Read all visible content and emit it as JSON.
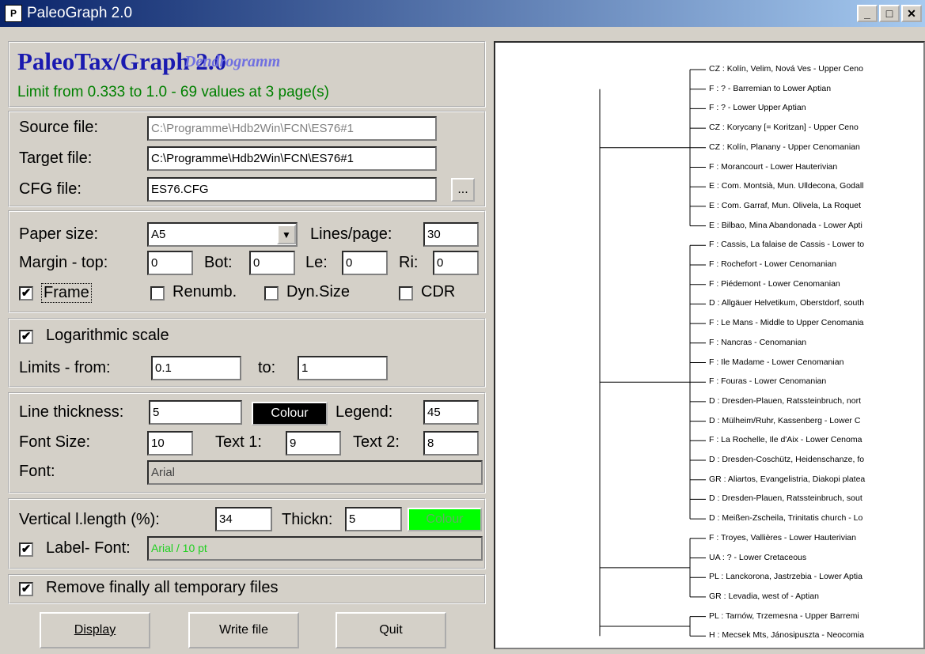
{
  "window": {
    "title": "PaleoGraph 2.0",
    "icon": "app-icon",
    "controls": [
      "_",
      "□",
      "✕"
    ]
  },
  "header": {
    "title": "PaleoTax/Graph 2.0",
    "subtitle": "Dendrogramm",
    "limit_text": "Limit from 0.333 to 1.0 - 69 values at 3 page(s)"
  },
  "files": {
    "source_label": "Source file:",
    "source_value": "C:\\Programme\\Hdb2Win\\FCN\\ES76#1",
    "target_label": "Target file:",
    "target_value": "C:\\Programme\\Hdb2Win\\FCN\\ES76#1",
    "cfg_label": "CFG file:",
    "cfg_value": "ES76.CFG",
    "browse_label": "..."
  },
  "paper": {
    "size_label": "Paper size:",
    "size_value": "A5",
    "lines_label": "Lines/page:",
    "lines_value": "30",
    "margin_label": "Margin - top:",
    "top_value": "0",
    "bot_label": "Bot:",
    "bot_value": "0",
    "le_label": "Le:",
    "le_value": "0",
    "ri_label": "Ri:",
    "ri_value": "0",
    "frame_label": "Frame",
    "frame_checked": "✔",
    "renumb_label": "Renumb.",
    "renumb_checked": "",
    "dynsize_label": "Dyn.Size",
    "dynsize_checked": "",
    "cdr_label": "CDR",
    "cdr_checked": ""
  },
  "scale": {
    "log_label": "Logarithmic scale",
    "log_checked": "✔",
    "limits_label": "Limits - from:",
    "from_value": "0.1",
    "to_label": "to:",
    "to_value": "1"
  },
  "lines": {
    "thickness_label": "Line thickness:",
    "thickness_value": "5",
    "colour_label": "Colour",
    "colour_color": "#000000",
    "legend_label": "Legend:",
    "legend_value": "45",
    "fontsize_label": "Font Size:",
    "fontsize_value": "10",
    "text1_label": "Text 1:",
    "text1_value": "9",
    "text2_label": "Text 2:",
    "text2_value": "8",
    "font_label": "Font:",
    "font_value": "Arial"
  },
  "vertical": {
    "length_label": "Vertical l.length (%):",
    "length_value": "34",
    "thickn_label": "Thickn:",
    "thickn_value": "5",
    "colour_label": "Colour",
    "colour_color": "#00ff00",
    "labelfont_label": "Label- Font:",
    "labelfont_checked": "✔",
    "labelfont_value": "Arial / 10 pt"
  },
  "cleanup": {
    "remove_label": "Remove finally all temporary files",
    "remove_checked": "✔"
  },
  "buttons": {
    "display": "Display",
    "write": "Write file",
    "quit": "Quit"
  },
  "dendrogram": {
    "leaves": [
      "CZ : Kolín, Velim, Nová Ves - Upper Ceno",
      "F : ? - Barremian to Lower Aptian",
      "F : ? - Lower Upper Aptian",
      "CZ : Korycany [= Koritzan] - Upper Ceno",
      "CZ : Kolín, Planany - Upper Cenomanian",
      "F : Morancourt - Lower Hauterivian",
      "E : Com. Montsià, Mun. Ulldecona, Godall",
      "E : Com. Garraf, Mun. Olivela, La Roquet",
      "E : Bilbao, Mina Abandonada - Lower Apti",
      "F : Cassis, La falaise de Cassis - Lower to",
      "F : Rochefort - Lower Cenomanian",
      "F : Piédemont - Lower Cenomanian",
      "D : Allgäuer Helvetikum, Oberstdorf, south",
      "F : Le Mans - Middle to Upper Cenomania",
      "F : Nancras - Cenomanian",
      "F : Ile Madame - Lower Cenomanian",
      "F : Fouras - Lower Cenomanian",
      "D : Dresden-Plauen, Ratssteinbruch, nort",
      "D : Mülheim/Ruhr, Kassenberg - Lower C",
      "F : La Rochelle, Ile d'Aix - Lower Cenoma",
      "D : Dresden-Coschütz, Heidenschanze, fo",
      "GR : Aliartos, Evangelistria, Diakopi platea",
      "D : Dresden-Plauen, Ratssteinbruch, sout",
      "D : Meißen-Zscheila, Trinitatis church - Lo",
      "F : Troyes, Vallières - Lower Hauterivian",
      "UA : ? - Lower Cretaceous",
      "PL : Lanckorona, Jastrzebia - Lower Aptia",
      "GR : Levadia, west of - Aptian",
      "PL : Tarnów, Trzemesna - Upper Barremi",
      "H : Mecsek Mts, Jánosipuszta - Neocomia"
    ]
  }
}
